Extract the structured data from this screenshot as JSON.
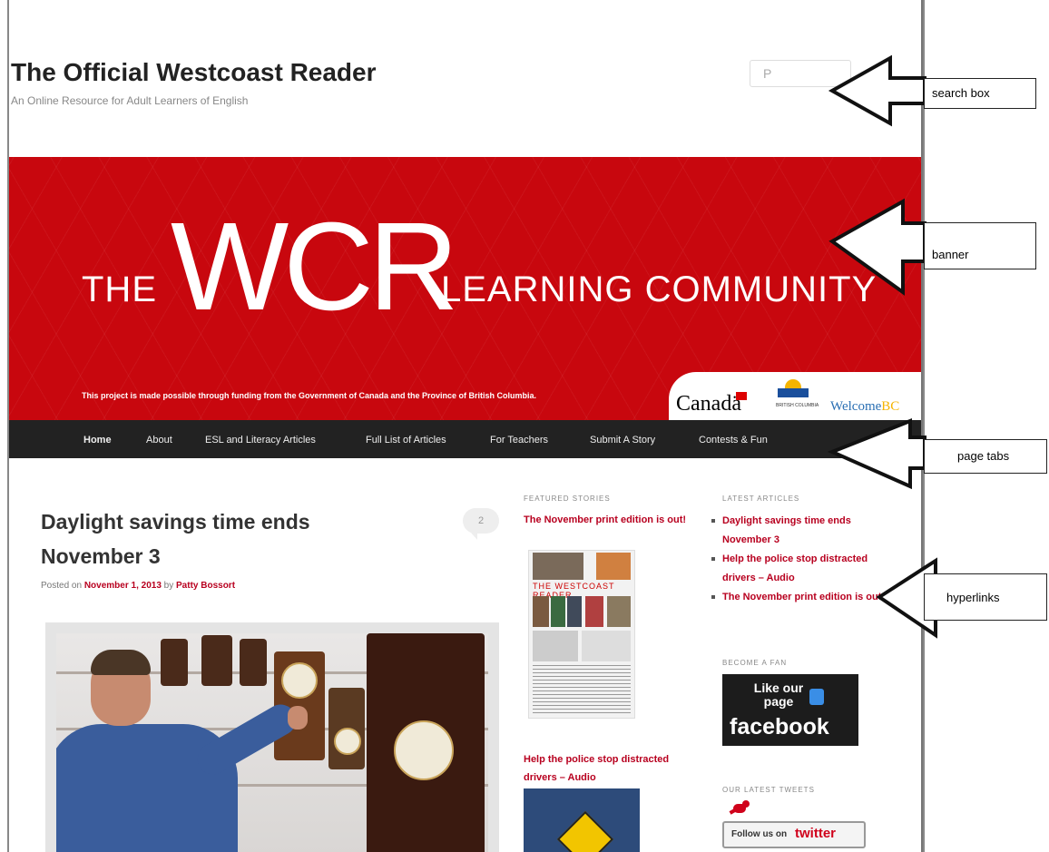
{
  "site": {
    "title": "The Official Westcoast Reader",
    "description": "An Online Resource for Adult Learners of English",
    "search_icon": "search-icon",
    "search_glyph": "P",
    "search_placeholder": ""
  },
  "banner": {
    "the": "THE",
    "wcr": "WCR",
    "learning_community": "LEARNING COMMUNITY",
    "funding_note": "This project is made possible through funding from the Government of Canada and the Province of British Columbia.",
    "logo_canada": "Canadä",
    "logo_bc": "BRITISH COLUMBIA",
    "logo_welcome": "Welcome",
    "logo_welcome_bc": "BC",
    "color": "#c8070e"
  },
  "nav": {
    "items": [
      {
        "label": "Home",
        "active": true
      },
      {
        "label": "About"
      },
      {
        "label": "ESL and Literacy Articles"
      },
      {
        "label": "Full List of Articles"
      },
      {
        "label": "For Teachers"
      },
      {
        "label": "Submit A Story"
      },
      {
        "label": "Contests & Fun"
      }
    ]
  },
  "post": {
    "title": "Daylight savings time ends November 3",
    "comment_count": "2",
    "posted_on_prefix": "Posted on",
    "date": "November 1, 2013",
    "by": "by",
    "author": "Patty Bossort"
  },
  "featured": {
    "heading": "FEATURED STORIES",
    "items": [
      {
        "title": "The November print edition is out!"
      },
      {
        "title": "Help the police stop distracted drivers – Audio"
      }
    ],
    "newspaper_masthead": "THE WESTCOAST READER"
  },
  "sidebar": {
    "latest_heading": "LATEST ARTICLES",
    "latest": [
      "Daylight savings time ends November 3",
      "Help the police stop distracted drivers – Audio",
      "The November print edition is out!"
    ],
    "fan_heading": "BECOME A FAN",
    "facebook_like": "Like our page",
    "facebook_word": "facebook",
    "tweets_heading": "OUR LATEST TWEETS",
    "twitter_follow": "Follow us on",
    "twitter_word": "twitter"
  },
  "annotations": {
    "search_box": "search box",
    "banner": "banner",
    "page_tabs": "page tabs",
    "hyperlinks": "hyperlinks"
  },
  "colors": {
    "link_red": "#b8001f",
    "nav_bg": "#222222"
  }
}
